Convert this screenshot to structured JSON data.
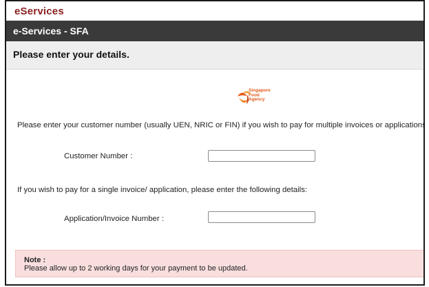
{
  "brand": {
    "title": "eServices"
  },
  "header": {
    "title": "e-Services - SFA"
  },
  "instruction": {
    "text": "Please enter your details."
  },
  "logo": {
    "name": "sfa-logo-icon",
    "lines": [
      "Singapore",
      "Food",
      "Agency"
    ],
    "color": "#e25a1c"
  },
  "form": {
    "multi_text": "Please enter your customer number (usually UEN, NRIC or FIN) if you wish to pay for multiple invoices or applications.",
    "customer_label": "Customer Number :",
    "customer_value": "",
    "single_text": "If you wish to pay for a single invoice/ application, please enter the following details:",
    "invoice_label": "Application/Invoice Number :",
    "invoice_value": ""
  },
  "note": {
    "title": "Note :",
    "body": "Please allow up to 2 working days for your payment to be updated."
  },
  "colors": {
    "brand_red": "#8b1f1f",
    "header_bg": "#3a3a3a",
    "instruction_bg": "#eeeeee",
    "note_bg": "#f9dede"
  }
}
